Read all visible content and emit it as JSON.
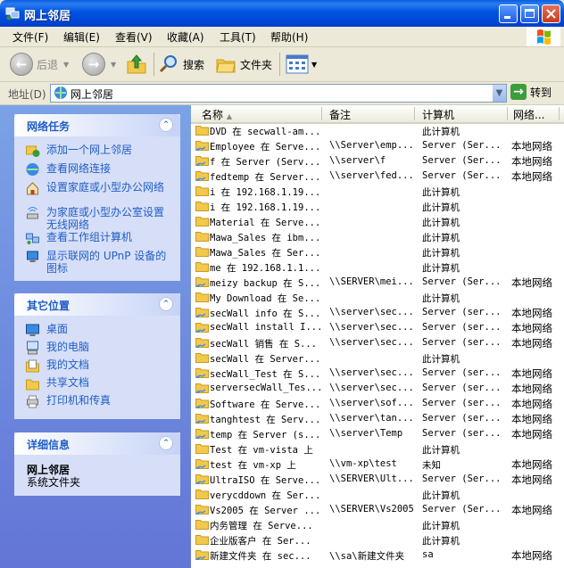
{
  "window": {
    "title": "网上邻居"
  },
  "menu": [
    "文件(F)",
    "编辑(E)",
    "查看(V)",
    "收藏(A)",
    "工具(T)",
    "帮助(H)"
  ],
  "toolbar": {
    "back": "后退",
    "search": "搜索",
    "folders": "文件夹"
  },
  "address": {
    "label": "地址(D)",
    "value": "网上邻居",
    "go": "转到"
  },
  "panels": {
    "network_tasks": {
      "title": "网络任务",
      "items": [
        "添加一个网上邻居",
        "查看网络连接",
        "设置家庭或小型办公网络",
        "为家庭或小型办公室设置无线网络",
        "查看工作组计算机",
        "显示联网的 UPnP 设备的图标"
      ]
    },
    "other_places": {
      "title": "其它位置",
      "items": [
        "桌面",
        "我的电脑",
        "我的文档",
        "共享文档",
        "打印机和传真"
      ]
    },
    "details": {
      "title": "详细信息",
      "name": "网上邻居",
      "type": "系统文件夹"
    }
  },
  "columns": {
    "name": "名称",
    "comment": "备注",
    "computer": "计算机",
    "network": "网络..."
  },
  "files": [
    {
      "name": "DVD 在 secwall-am...",
      "comment": "",
      "computer": "此计算机",
      "network": "",
      "kind": "folder"
    },
    {
      "name": "Employee 在 Serve...",
      "comment": "\\\\Server\\emp...",
      "computer": "Server (Ser...",
      "network": "本地网络",
      "kind": "share"
    },
    {
      "name": "f 在 Server (Serv...",
      "comment": "\\\\server\\f",
      "computer": "Server (Ser...",
      "network": "本地网络",
      "kind": "share"
    },
    {
      "name": "fedtemp 在 Server...",
      "comment": "\\\\server\\fed...",
      "computer": "Server (Ser...",
      "network": "本地网络",
      "kind": "share"
    },
    {
      "name": "i 在 192.168.1.19...",
      "comment": "",
      "computer": "此计算机",
      "network": "",
      "kind": "folder"
    },
    {
      "name": "i 在 192.168.1.19...",
      "comment": "",
      "computer": "此计算机",
      "network": "",
      "kind": "folder"
    },
    {
      "name": "Material 在 Serve...",
      "comment": "",
      "computer": "此计算机",
      "network": "",
      "kind": "folder"
    },
    {
      "name": "Mawa_Sales 在 ibm...",
      "comment": "",
      "computer": "此计算机",
      "network": "",
      "kind": "folder"
    },
    {
      "name": "Mawa_Sales 在 Ser...",
      "comment": "",
      "computer": "此计算机",
      "network": "",
      "kind": "folder"
    },
    {
      "name": "me 在 192.168.1.1...",
      "comment": "",
      "computer": "此计算机",
      "network": "",
      "kind": "folder"
    },
    {
      "name": "meizy backup 在 S...",
      "comment": "\\\\SERVER\\mei...",
      "computer": "Server (Ser...",
      "network": "本地网络",
      "kind": "share"
    },
    {
      "name": "My Download 在 Se...",
      "comment": "",
      "computer": "此计算机",
      "network": "",
      "kind": "folder"
    },
    {
      "name": "secWall info 在 S...",
      "comment": "\\\\server\\sec...",
      "computer": "Server (ser...",
      "network": "本地网络",
      "kind": "share"
    },
    {
      "name": "secWall install I...",
      "comment": "\\\\server\\sec...",
      "computer": "Server (ser...",
      "network": "本地网络",
      "kind": "share"
    },
    {
      "name": "secWall 销售 在 S...",
      "comment": "\\\\server\\sec...",
      "computer": "Server (ser...",
      "network": "本地网络",
      "kind": "share"
    },
    {
      "name": "secWall 在 Server...",
      "comment": "",
      "computer": "此计算机",
      "network": "",
      "kind": "folder"
    },
    {
      "name": "secWall_Test 在 S...",
      "comment": "\\\\server\\sec...",
      "computer": "Server (ser...",
      "network": "本地网络",
      "kind": "share"
    },
    {
      "name": "serversecWall_Tes...",
      "comment": "\\\\server\\sec...",
      "computer": "Server (ser...",
      "network": "本地网络",
      "kind": "share"
    },
    {
      "name": "Software 在 Serve...",
      "comment": "\\\\server\\sof...",
      "computer": "Server (ser...",
      "network": "本地网络",
      "kind": "share"
    },
    {
      "name": "tanghtest 在 Serv...",
      "comment": "\\\\server\\tan...",
      "computer": "Server (ser...",
      "network": "本地网络",
      "kind": "share"
    },
    {
      "name": "temp 在 Server (s...",
      "comment": "\\\\server\\Temp",
      "computer": "Server (ser...",
      "network": "本地网络",
      "kind": "share"
    },
    {
      "name": "Test 在 vm-vista 上",
      "comment": "",
      "computer": "此计算机",
      "network": "",
      "kind": "folder"
    },
    {
      "name": "test 在 vm-xp 上",
      "comment": "\\\\vm-xp\\test",
      "computer": "未知",
      "network": "本地网络",
      "kind": "share"
    },
    {
      "name": "UltraISO 在 Serve...",
      "comment": "\\\\SERVER\\Ult...",
      "computer": "Server (Ser...",
      "network": "本地网络",
      "kind": "share"
    },
    {
      "name": "verycddown 在 Ser...",
      "comment": "",
      "computer": "此计算机",
      "network": "",
      "kind": "folder"
    },
    {
      "name": "Vs2005 在 Server ...",
      "comment": "\\\\SERVER\\Vs2005",
      "computer": "Server (Ser...",
      "network": "本地网络",
      "kind": "share"
    },
    {
      "name": "内务管理 在 Serve...",
      "comment": "",
      "computer": "此计算机",
      "network": "",
      "kind": "folder"
    },
    {
      "name": "企业版客户 在 Ser...",
      "comment": "",
      "computer": "此计算机",
      "network": "",
      "kind": "folder"
    },
    {
      "name": "新建文件夹 在 sec...",
      "comment": "\\\\sa\\新建文件夹",
      "computer": "sa",
      "network": "本地网络",
      "kind": "share"
    }
  ]
}
